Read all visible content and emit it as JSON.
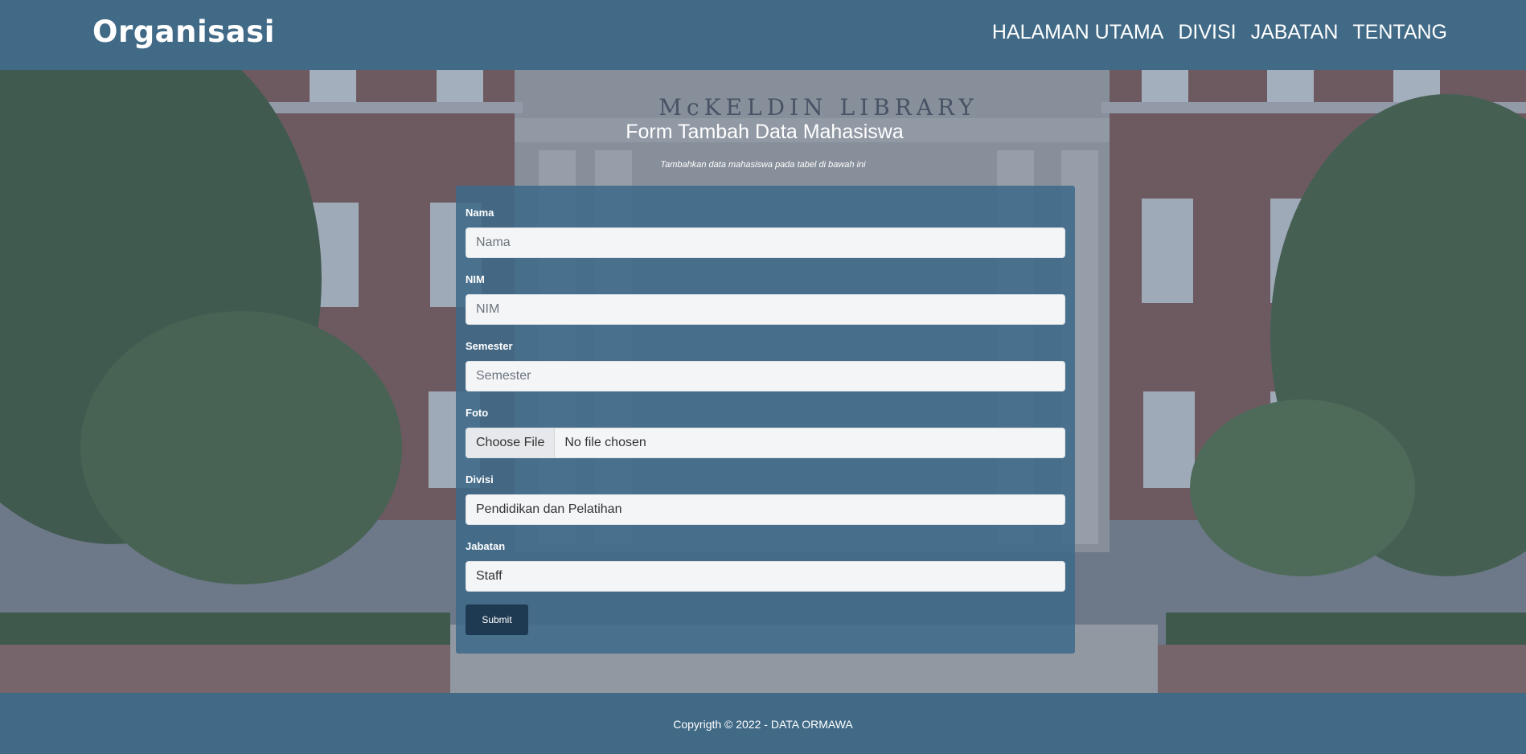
{
  "navbar": {
    "brand": "Organisasi",
    "links": [
      "HALAMAN UTAMA",
      "DIVISI",
      "JABATAN",
      "TENTANG"
    ]
  },
  "hero": {
    "building_sign": "McKELDIN LIBRARY"
  },
  "page": {
    "title": "Form Tambah Data Mahasiswa",
    "subtitle": "Tambahkan data mahasiswa pada tabel di bawah ini"
  },
  "form": {
    "nama": {
      "label": "Nama",
      "placeholder": "Nama",
      "value": ""
    },
    "nim": {
      "label": "NIM",
      "placeholder": "NIM",
      "value": ""
    },
    "semester": {
      "label": "Semester",
      "placeholder": "Semester",
      "value": ""
    },
    "foto": {
      "label": "Foto",
      "button": "Choose File",
      "status": "No file chosen"
    },
    "divisi": {
      "label": "Divisi",
      "selected": "Pendidikan dan Pelatihan"
    },
    "jabatan": {
      "label": "Jabatan",
      "selected": "Staff"
    },
    "submit_label": "Submit"
  },
  "footer": {
    "text": "Copyrigth © 2022 - DATA ORMAWA"
  },
  "colors": {
    "navbar": "#416a87",
    "card": "#3f6a89",
    "submit": "#1e3a52"
  }
}
